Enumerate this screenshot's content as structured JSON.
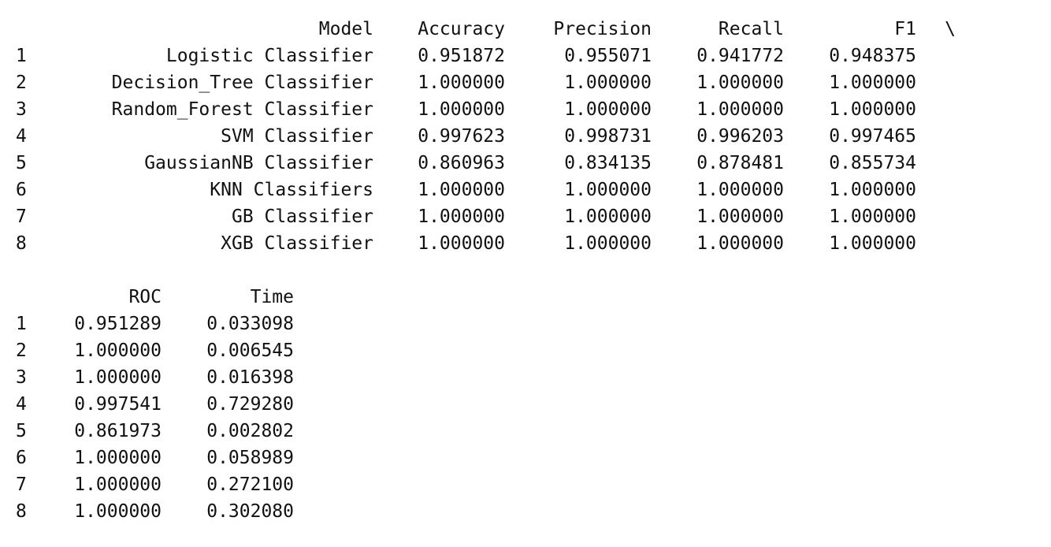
{
  "table_top": {
    "headers": {
      "index": "",
      "model": "Model",
      "accuracy": "Accuracy",
      "precision": "Precision",
      "recall": "Recall",
      "f1": "F1",
      "continuation": "\\"
    },
    "rows": [
      {
        "index": "1",
        "model": "Logistic Classifier",
        "accuracy": "0.951872",
        "precision": "0.955071",
        "recall": "0.941772",
        "f1": "0.948375"
      },
      {
        "index": "2",
        "model": "Decision_Tree Classifier",
        "accuracy": "1.000000",
        "precision": "1.000000",
        "recall": "1.000000",
        "f1": "1.000000"
      },
      {
        "index": "3",
        "model": "Random_Forest Classifier",
        "accuracy": "1.000000",
        "precision": "1.000000",
        "recall": "1.000000",
        "f1": "1.000000"
      },
      {
        "index": "4",
        "model": "SVM Classifier",
        "accuracy": "0.997623",
        "precision": "0.998731",
        "recall": "0.996203",
        "f1": "0.997465"
      },
      {
        "index": "5",
        "model": "GaussianNB Classifier",
        "accuracy": "0.860963",
        "precision": "0.834135",
        "recall": "0.878481",
        "f1": "0.855734"
      },
      {
        "index": "6",
        "model": "KNN Classifiers",
        "accuracy": "1.000000",
        "precision": "1.000000",
        "recall": "1.000000",
        "f1": "1.000000"
      },
      {
        "index": "7",
        "model": "GB Classifier",
        "accuracy": "1.000000",
        "precision": "1.000000",
        "recall": "1.000000",
        "f1": "1.000000"
      },
      {
        "index": "8",
        "model": "XGB Classifier",
        "accuracy": "1.000000",
        "precision": "1.000000",
        "recall": "1.000000",
        "f1": "1.000000"
      }
    ]
  },
  "table_bottom": {
    "headers": {
      "index": "",
      "roc": "ROC",
      "time": "Time"
    },
    "rows": [
      {
        "index": "1",
        "roc": "0.951289",
        "time": "0.033098"
      },
      {
        "index": "2",
        "roc": "1.000000",
        "time": "0.006545"
      },
      {
        "index": "3",
        "roc": "1.000000",
        "time": "0.016398"
      },
      {
        "index": "4",
        "roc": "0.997541",
        "time": "0.729280"
      },
      {
        "index": "5",
        "roc": "0.861973",
        "time": "0.002802"
      },
      {
        "index": "6",
        "roc": "1.000000",
        "time": "0.058989"
      },
      {
        "index": "7",
        "roc": "1.000000",
        "time": "0.272100"
      },
      {
        "index": "8",
        "roc": "1.000000",
        "time": "0.302080"
      }
    ]
  }
}
